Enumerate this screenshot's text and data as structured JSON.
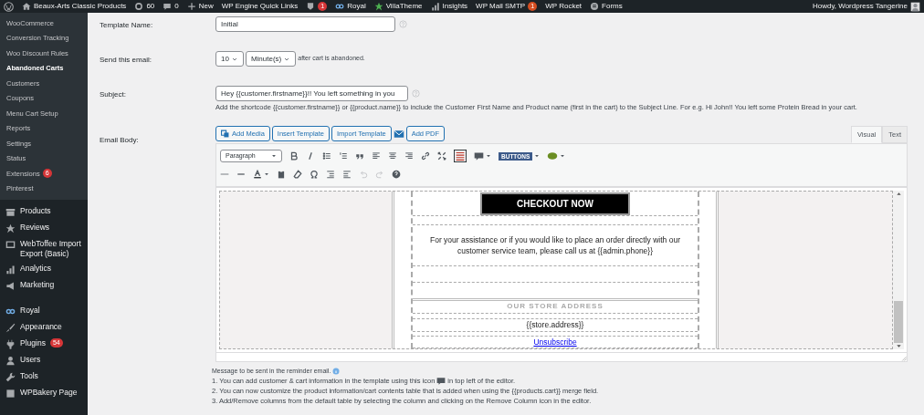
{
  "admin_bar": {
    "items": [
      {
        "label": "Beaux-Arts Classic Products"
      },
      {
        "label": "60"
      },
      {
        "label": "0"
      },
      {
        "label": "New"
      },
      {
        "label": "WP Engine Quick Links"
      },
      {
        "badge": "1",
        "color": "#d63638"
      },
      {
        "label": "Royal"
      },
      {
        "label": "VillaTheme"
      },
      {
        "label": "Insights"
      },
      {
        "label": "WP Mail SMTP",
        "badge": "1",
        "color": "#d54e21"
      },
      {
        "label": "WP Rocket"
      },
      {
        "label": "Forms"
      }
    ],
    "greeting": "Howdy, Wordpress Tangerine"
  },
  "sidebar": {
    "submenu": [
      {
        "label": "WooCommerce",
        "selected": false
      },
      {
        "label": "Conversion Tracking",
        "selected": false
      },
      {
        "label": "Woo Discount Rules",
        "selected": false
      },
      {
        "label": "Abandoned Carts",
        "selected": true
      },
      {
        "label": "Customers",
        "selected": false
      },
      {
        "label": "Coupons",
        "selected": false
      },
      {
        "label": "Menu Cart Setup",
        "selected": false
      },
      {
        "label": "Reports",
        "selected": false
      },
      {
        "label": "Settings",
        "selected": false
      },
      {
        "label": "Status",
        "selected": false
      },
      {
        "label": "Extensions",
        "selected": false,
        "badge": "6"
      },
      {
        "label": "Pinterest",
        "selected": false
      }
    ],
    "menu": [
      {
        "label": "Products"
      },
      {
        "label": "Reviews"
      },
      {
        "label": "WebToffee Import Export (Basic)"
      },
      {
        "label": "Analytics"
      },
      {
        "label": "Marketing"
      },
      {
        "label": "Royal"
      },
      {
        "label": "Appearance"
      },
      {
        "label": "Plugins",
        "badge": "54"
      },
      {
        "label": "Users"
      },
      {
        "label": "Tools"
      },
      {
        "label": "WPBakery Page"
      }
    ]
  },
  "form": {
    "template_name": {
      "label": "Template Name:",
      "value": "Initial"
    },
    "send": {
      "label": "Send this email:",
      "number": "10",
      "unit": "Minute(s)",
      "suffix": "after cart is abandoned."
    },
    "subject": {
      "label": "Subject:",
      "value": "Hey {{customer.firstname}}!! You left something in you",
      "help": "Add the shortcode {{customer.firstname}} or {{product.name}} to include the Customer First Name and Product name (first in the cart) to the Subject Line. For e.g. Hi John!! You left some Protein Bread in your cart."
    },
    "body": {
      "label": "Email Body:",
      "media_buttons": [
        "Add Media",
        "Insert Template",
        "Import Template",
        "Add PDF"
      ],
      "tabs": [
        {
          "label": "Visual",
          "selected": true
        },
        {
          "label": "Text",
          "selected": false
        }
      ],
      "format": "Paragraph",
      "buttons_label": "BUTTONS",
      "email": {
        "button": "CHECKOUT NOW",
        "assist": "For your assistance or if you would like to place an order directly with our customer service team, please call us at {{admin.phone}}",
        "store_heading": "OUR STORE ADDRESS",
        "store_address": "{{store.address}}",
        "unsubscribe": "Unsubscribe"
      }
    }
  },
  "notes": {
    "intro": "Message to be sent in the reminder email.",
    "items": [
      {
        "before": "1. You can add customer & cart information in the template using this icon",
        "after": "in top left of the editor."
      },
      {
        "before": "2. You can now customize the product information/cart contents table that is added when using the {{products.cart}} merge field."
      },
      {
        "before": "3. Add/Remove columns from the default table by selecting the column and clicking on the Remove Column icon in the editor."
      }
    ]
  }
}
